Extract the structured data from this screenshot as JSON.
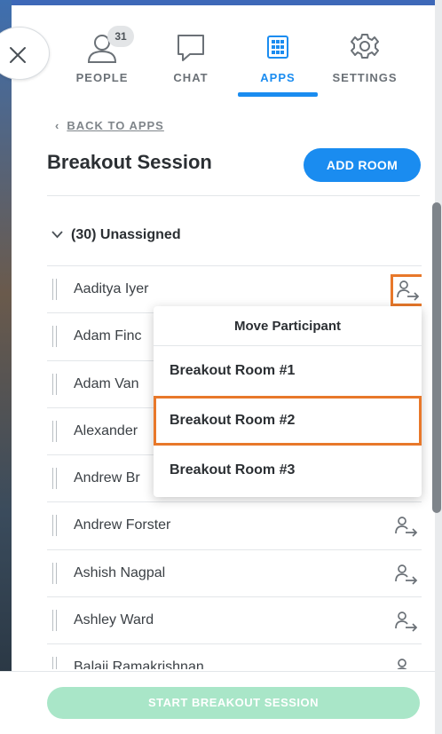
{
  "nav": {
    "tabs": [
      {
        "label": "PEOPLE",
        "icon": "people-icon",
        "badge": "31"
      },
      {
        "label": "CHAT",
        "icon": "chat-icon"
      },
      {
        "label": "APPS",
        "icon": "apps-grid-icon",
        "active": true
      },
      {
        "label": "SETTINGS",
        "icon": "gear-icon"
      }
    ]
  },
  "back_link": "BACK TO APPS",
  "page_title": "Breakout Session",
  "add_room_label": "ADD ROOM",
  "group": {
    "label": "(30) Unassigned",
    "icon": "chevron-down-icon"
  },
  "participants": [
    "Aaditya Iyer",
    "Adam Finc",
    "Adam Van",
    "Alexander",
    "Andrew Br",
    "Andrew Forster",
    "Ashish Nagpal",
    "Ashley Ward",
    "Balaji Ramakrishnan"
  ],
  "move_popup": {
    "title": "Move Participant",
    "rooms": [
      "Breakout Room #1",
      "Breakout Room #2",
      "Breakout Room #3"
    ]
  },
  "start_label": "START BREAKOUT SESSION",
  "colors": {
    "accent": "#1a8cf0",
    "highlight": "#e8782a",
    "start_button_disabled": "#a9e6c8"
  }
}
